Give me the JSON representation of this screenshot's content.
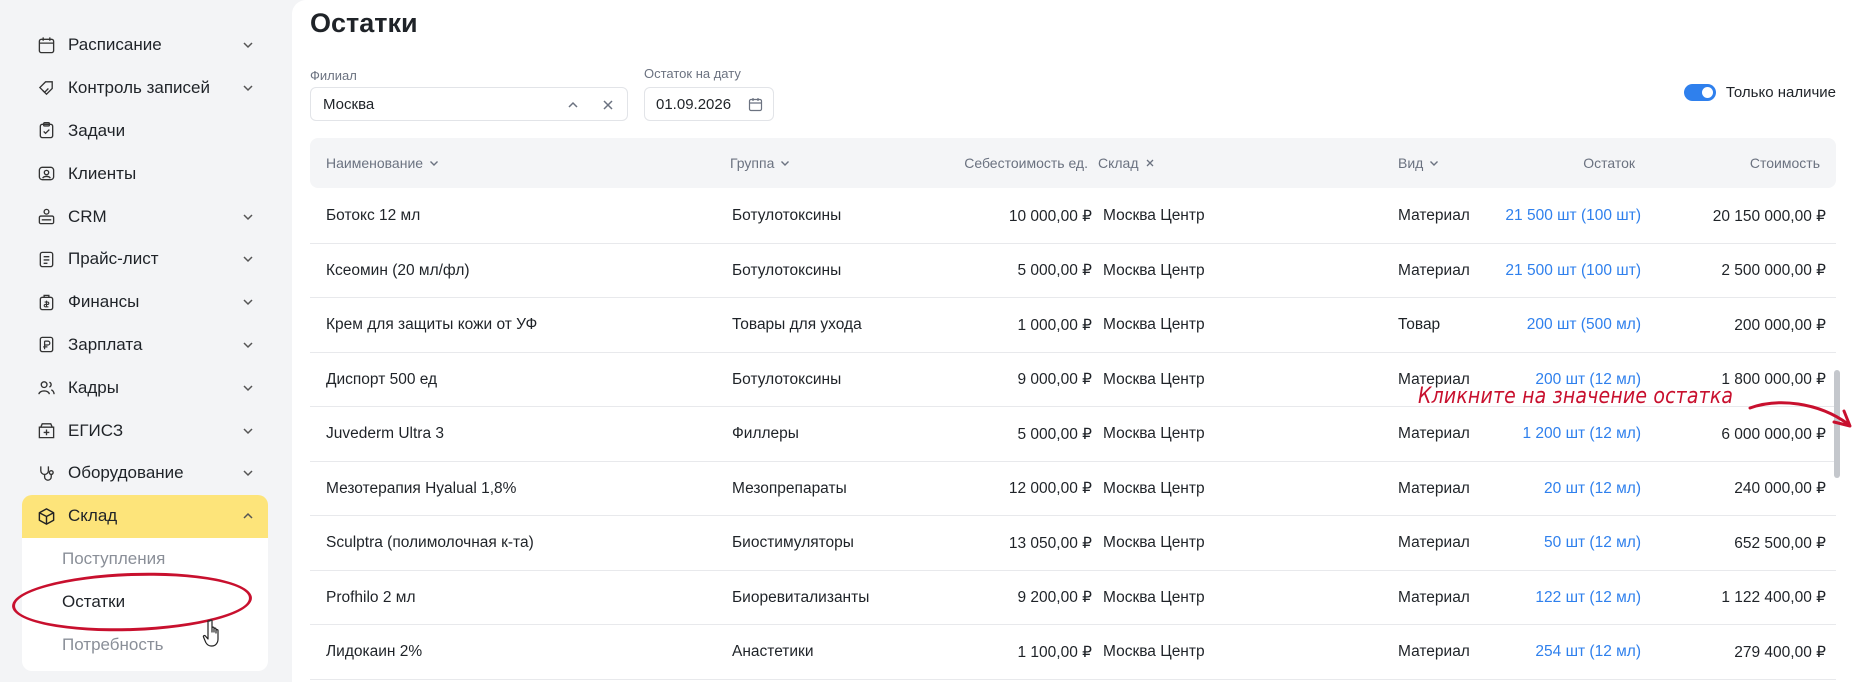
{
  "sidebar": {
    "items": [
      {
        "label": "Расписание",
        "icon": "calendar-icon",
        "has_chevron": true
      },
      {
        "label": "Контроль записей",
        "icon": "tag-check-icon",
        "has_chevron": true
      },
      {
        "label": "Задачи",
        "icon": "clipboard-icon",
        "has_chevron": false
      },
      {
        "label": "Клиенты",
        "icon": "client-card-icon",
        "has_chevron": false
      },
      {
        "label": "CRM",
        "icon": "crm-icon",
        "has_chevron": true
      },
      {
        "label": "Прайс-лист",
        "icon": "price-list-icon",
        "has_chevron": true
      },
      {
        "label": "Финансы",
        "icon": "finance-icon",
        "has_chevron": true
      },
      {
        "label": "Зарплата",
        "icon": "salary-icon",
        "has_chevron": true
      },
      {
        "label": "Кадры",
        "icon": "people-icon",
        "has_chevron": true
      },
      {
        "label": "ЕГИСЗ",
        "icon": "registry-icon",
        "has_chevron": true
      },
      {
        "label": "Оборудование",
        "icon": "stethoscope-icon",
        "has_chevron": true
      },
      {
        "label": "Склад",
        "icon": "box-icon",
        "has_chevron": true,
        "active": true
      }
    ],
    "sub_items": [
      {
        "label": "Поступления"
      },
      {
        "label": "Остатки",
        "current": true
      },
      {
        "label": "Потребность"
      }
    ]
  },
  "page": {
    "title": "Остатки"
  },
  "filters": {
    "branch_label": "Филиал",
    "branch_value": "Москва",
    "date_label": "Остаток на дату",
    "date_value": "01.09.2026",
    "toggle_label": "Только наличие",
    "toggle_on": true
  },
  "table": {
    "columns": {
      "name": "Наименование",
      "group": "Группа",
      "unit_cost": "Себестоимость ед.",
      "warehouse": "Склад",
      "kind": "Вид",
      "stock": "Остаток",
      "cost": "Стоимость"
    },
    "rows": [
      {
        "name": "Ботокс 12 мл",
        "group": "Ботулотоксины",
        "unit_cost": "10 000,00 ₽",
        "warehouse": "Москва Центр",
        "kind": "Материал",
        "stock": "21 500 шт (100 шт)",
        "cost": "20 150 000,00 ₽"
      },
      {
        "name": "Ксеомин (20 мл/фл)",
        "group": "Ботулотоксины",
        "unit_cost": "5 000,00 ₽",
        "warehouse": "Москва Центр",
        "kind": "Материал",
        "stock": "21 500 шт (100 шт)",
        "cost": "2 500 000,00 ₽"
      },
      {
        "name": "Крем для защиты кожи от УФ",
        "group": "Товары для ухода",
        "unit_cost": "1 000,00 ₽",
        "warehouse": "Москва Центр",
        "kind": "Товар",
        "stock": "200 шт (500 мл)",
        "cost": "200 000,00 ₽"
      },
      {
        "name": "Диспорт 500 ед",
        "group": "Ботулотоксины",
        "unit_cost": "9 000,00 ₽",
        "warehouse": "Москва Центр",
        "kind": "Материал",
        "stock": "200 шт (12 мл)",
        "cost": "1 800 000,00 ₽"
      },
      {
        "name": "Juvederm Ultra 3",
        "group": "Филлеры",
        "unit_cost": "5 000,00 ₽",
        "warehouse": "Москва Центр",
        "kind": "Материал",
        "stock": "1 200 шт (12 мл)",
        "cost": "6 000 000,00 ₽"
      },
      {
        "name": "Мезотерапия Hyalual 1,8%",
        "group": "Мезопрепараты",
        "unit_cost": "12 000,00 ₽",
        "warehouse": "Москва Центр",
        "kind": "Материал",
        "stock": "20 шт (12 мл)",
        "cost": "240 000,00 ₽"
      },
      {
        "name": "Sculptra (полимолочная к-та)",
        "group": "Биостимуляторы",
        "unit_cost": "13 050,00 ₽",
        "warehouse": "Москва Центр",
        "kind": "Материал",
        "stock": "50 шт (12 мл)",
        "cost": "652 500,00 ₽"
      },
      {
        "name": "Profhilo 2 мл",
        "group": "Биоревитализанты",
        "unit_cost": "9 200,00 ₽",
        "warehouse": "Москва Центр",
        "kind": "Материал",
        "stock": "122 шт (12 мл)",
        "cost": "1 122 400,00 ₽"
      },
      {
        "name": "Лидокаин 2%",
        "group": "Анастетики",
        "unit_cost": "1 100,00 ₽",
        "warehouse": "Москва Центр",
        "kind": "Материал",
        "stock": "254 шт (12 мл)",
        "cost": "279 400,00 ₽"
      }
    ]
  },
  "annotation": {
    "text": "Кликните на значение остатка",
    "color": "#c8102e"
  },
  "colors": {
    "accent": "#2f80ed",
    "active_nav": "#fde47a"
  }
}
